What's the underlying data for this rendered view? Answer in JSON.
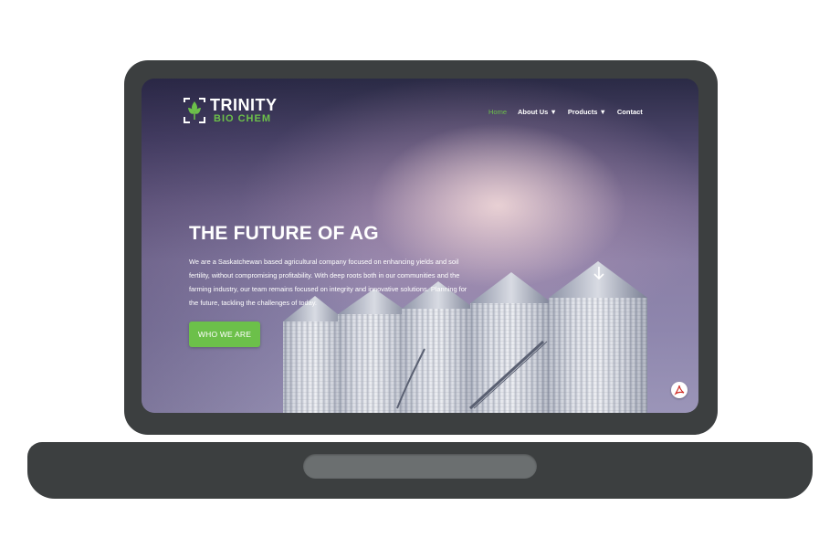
{
  "site": {
    "logo": {
      "line1": "TRINITY",
      "line2": "BIO CHEM",
      "icon": "trinity-leaf-logo-icon"
    },
    "nav": [
      {
        "label": "Home",
        "active": true
      },
      {
        "label": "About Us ▼",
        "active": false
      },
      {
        "label": "Products ▼",
        "active": false
      },
      {
        "label": "Contact",
        "active": false
      }
    ]
  },
  "hero": {
    "title": "THE FUTURE OF AG",
    "body": "We are a Saskatchewan based agricultural company focused on enhancing yields and soil fertility, without compromising profitability. With deep roots both in our communities and the farming industry, our team remains focused on integrity and innovative solutions. Planning for the future, tackling the challenges of today.",
    "cta_label": "WHO WE ARE",
    "scroll_icon": "arrow-down-icon",
    "pdf_icon": "pdf-icon"
  },
  "colors": {
    "accent": "#6cc04a",
    "device_frame": "#3c3f40",
    "trackpad": "#6b6f70"
  }
}
